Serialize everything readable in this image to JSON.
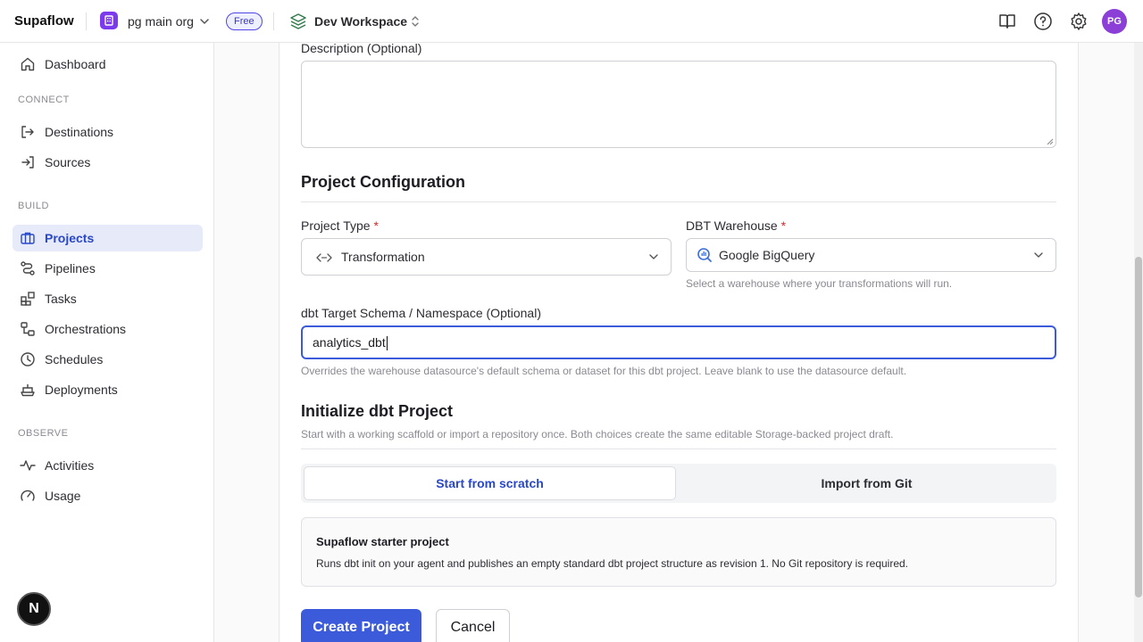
{
  "topbar": {
    "brand": "Supaflow",
    "org_name": "pg main org",
    "plan_badge": "Free",
    "workspace_name": "Dev Workspace",
    "avatar_initials": "PG",
    "icons": [
      "docs-book-icon",
      "help-icon",
      "settings-gear-icon"
    ]
  },
  "sidebar": {
    "dashboard": "Dashboard",
    "sections": {
      "connect": "CONNECT",
      "build": "BUILD",
      "observe": "OBSERVE"
    },
    "items": {
      "destinations": "Destinations",
      "sources": "Sources",
      "projects": "Projects",
      "pipelines": "Pipelines",
      "tasks": "Tasks",
      "orchestrations": "Orchestrations",
      "schedules": "Schedules",
      "deployments": "Deployments",
      "activities": "Activities",
      "usage": "Usage"
    },
    "active_item": "Projects",
    "floating_badge": "N"
  },
  "form": {
    "description_label": "Description (Optional)",
    "description_value": "",
    "config_heading": "Project Configuration",
    "project_type_label": "Project Type",
    "project_type_value": "Transformation",
    "warehouse_label": "DBT Warehouse",
    "warehouse_value": "Google BigQuery",
    "warehouse_help": "Select a warehouse where your transformations will run.",
    "required_mark": "*",
    "schema_label": "dbt Target Schema / Namespace (Optional)",
    "schema_value": "analytics_dbt",
    "schema_help": "Overrides the warehouse datasource's default schema or dataset for this dbt project. Leave blank to use the datasource default.",
    "init_heading": "Initialize dbt Project",
    "init_subtitle": "Start with a working scaffold or import a repository once. Both choices create the same editable Storage-backed project draft.",
    "tabs": {
      "scratch": "Start from scratch",
      "git": "Import from Git"
    },
    "active_tab": "Start from scratch",
    "starter_title": "Supaflow starter project",
    "starter_desc": "Runs dbt init on your agent and publishes an empty standard dbt project structure as revision 1. No Git repository is required.",
    "create_button": "Create Project",
    "cancel_button": "Cancel"
  },
  "colors": {
    "accent": "#3b5bdb",
    "active_nav_bg": "#e6eaf9",
    "org_icon": "#7c3aed",
    "avatar": "#8b3fd6",
    "required": "#dc2626"
  }
}
